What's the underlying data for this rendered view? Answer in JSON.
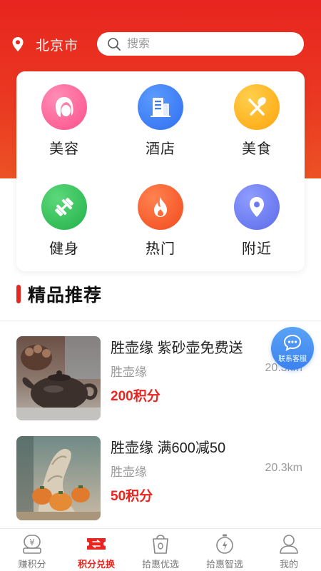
{
  "header": {
    "city": "北京市",
    "search_placeholder": "搜索"
  },
  "categories": [
    {
      "label": "美容",
      "icon": "face-icon",
      "color": "#ff5c93"
    },
    {
      "label": "酒店",
      "icon": "building-icon",
      "color": "#3c7cf2"
    },
    {
      "label": "美食",
      "icon": "fork-spoon-icon",
      "color": "#ffb01f"
    },
    {
      "label": "健身",
      "icon": "dumbbell-icon",
      "color": "#2fbf56"
    },
    {
      "label": "热门",
      "icon": "flame-icon",
      "color": "#ff5a2e"
    },
    {
      "label": "附近",
      "icon": "location-icon",
      "color": "#6c7cf0"
    }
  ],
  "section": {
    "title": "精品推荐"
  },
  "products": [
    {
      "title": "胜壶缘 紫砂壶免费送",
      "shop": "胜壶缘",
      "distance": "20.3km",
      "points": "200积分"
    },
    {
      "title": "胜壶缘 满600减50",
      "shop": "胜壶缘",
      "distance": "20.3km",
      "points": "50积分"
    }
  ],
  "service_button": {
    "label": "联系客服"
  },
  "tabbar": {
    "active_index": 1,
    "items": [
      {
        "label": "赚积分",
        "icon": "yen-coin-icon"
      },
      {
        "label": "积分兑换",
        "icon": "exchange-ticket-icon"
      },
      {
        "label": "拾惠优选",
        "icon": "bag-icon"
      },
      {
        "label": "拾惠智选",
        "icon": "stopwatch-icon"
      },
      {
        "label": "我的",
        "icon": "user-icon"
      }
    ]
  },
  "colors": {
    "brand_red": "#e8251f",
    "service_blue": "#3b82f0"
  }
}
